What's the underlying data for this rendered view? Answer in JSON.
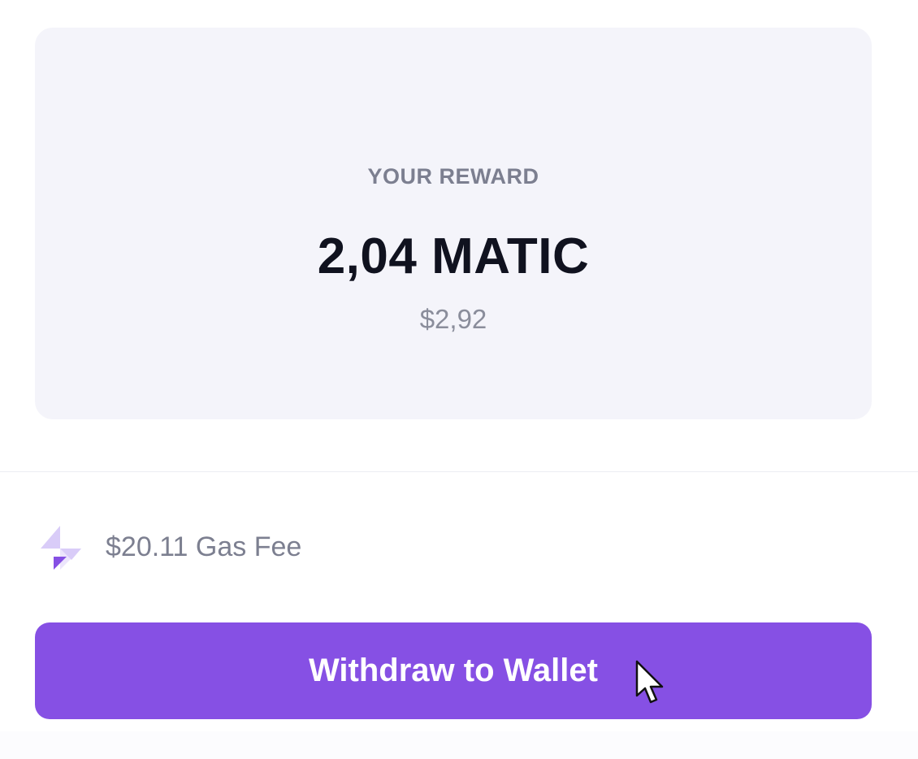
{
  "reward": {
    "label": "YOUR REWARD",
    "amount": "2,04 MATIC",
    "usd_value": "$2,92"
  },
  "gas": {
    "icon": "lightning-icon",
    "text": "$20.11 Gas Fee"
  },
  "actions": {
    "withdraw_label": "Withdraw to Wallet"
  },
  "colors": {
    "card_background": "#f4f4fa",
    "accent": "#8650e4",
    "amount_text": "#10121f",
    "muted_text": "#7c7f90",
    "icon_light": "#d9ccf8",
    "icon_dark": "#8650e4"
  }
}
